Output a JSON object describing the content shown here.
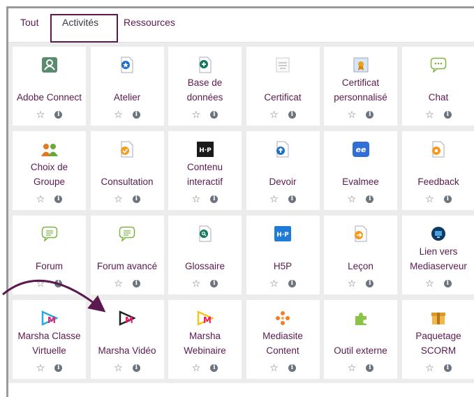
{
  "tabs": [
    {
      "label": "Tout"
    },
    {
      "label": "Activités"
    },
    {
      "label": "Ressources"
    }
  ],
  "cards": [
    {
      "name": "Adobe Connect",
      "icon": "adobe-connect-icon"
    },
    {
      "name": "Atelier",
      "icon": "atelier-icon"
    },
    {
      "name": "Base de données",
      "icon": "database-icon"
    },
    {
      "name": "Certificat",
      "icon": "certificate-icon"
    },
    {
      "name": "Certificat personnalisé",
      "icon": "custom-certificate-icon"
    },
    {
      "name": "Chat",
      "icon": "chat-icon"
    },
    {
      "name": "Choix de Groupe",
      "icon": "group-choice-icon"
    },
    {
      "name": "Consultation",
      "icon": "consultation-icon"
    },
    {
      "name": "Contenu interactif",
      "icon": "h5p-black-icon"
    },
    {
      "name": "Devoir",
      "icon": "assignment-icon"
    },
    {
      "name": "Evalmee",
      "icon": "evalmee-icon"
    },
    {
      "name": "Feedback",
      "icon": "feedback-icon"
    },
    {
      "name": "Forum",
      "icon": "forum-icon"
    },
    {
      "name": "Forum avancé",
      "icon": "advanced-forum-icon"
    },
    {
      "name": "Glossaire",
      "icon": "glossary-icon"
    },
    {
      "name": "H5P",
      "icon": "h5p-blue-icon"
    },
    {
      "name": "Leçon",
      "icon": "lesson-icon"
    },
    {
      "name": "Lien vers Mediaserveur",
      "icon": "mediaserver-icon"
    },
    {
      "name": "Marsha Classe Virtuelle",
      "icon": "marsha-classroom-icon"
    },
    {
      "name": "Marsha Vidéo",
      "icon": "marsha-video-icon"
    },
    {
      "name": "Marsha Webinaire",
      "icon": "marsha-webinar-icon"
    },
    {
      "name": "Mediasite Content",
      "icon": "mediasite-icon"
    },
    {
      "name": "Outil externe",
      "icon": "puzzle-icon"
    },
    {
      "name": "Paquetage SCORM",
      "icon": "scorm-package-icon"
    }
  ],
  "colors": {
    "link": "#5a1a4f",
    "grid_bg": "#ececec",
    "accent_outline": "#5a1a4f"
  }
}
